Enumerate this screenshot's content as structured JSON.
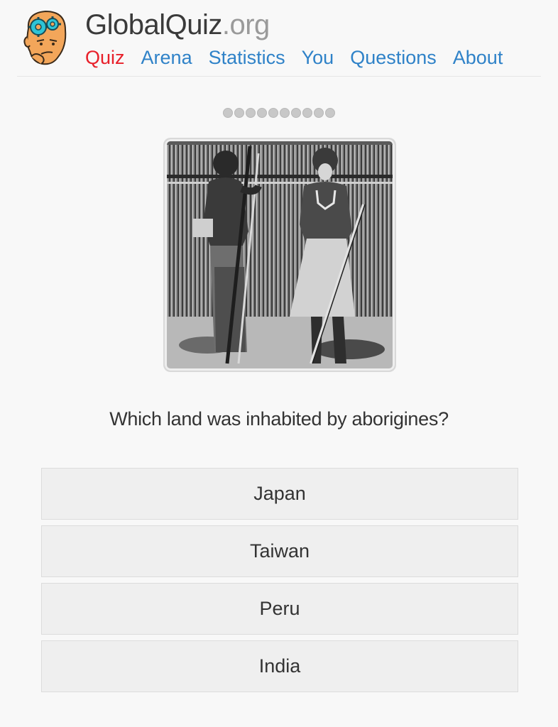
{
  "header": {
    "brand_name": "GlobalQuiz",
    "brand_tld": ".org",
    "nav": [
      {
        "label": "Quiz",
        "active": true
      },
      {
        "label": "Arena",
        "active": false
      },
      {
        "label": "Statistics",
        "active": false
      },
      {
        "label": "You",
        "active": false
      },
      {
        "label": "Questions",
        "active": false
      },
      {
        "label": "About",
        "active": false
      }
    ],
    "logo_icon": "thinking-face-gears-icon"
  },
  "progress": {
    "total": 10,
    "current": 0
  },
  "photo": {
    "style": "black-and-white historical photograph of two men with spears before a bamboo fence"
  },
  "question": {
    "text": "Which land was inhabited by aborigines?"
  },
  "answers": [
    {
      "label": "Japan"
    },
    {
      "label": "Taiwan"
    },
    {
      "label": "Peru"
    },
    {
      "label": "India"
    }
  ],
  "colors": {
    "nav_link": "#2f82c8",
    "nav_active": "#e8202a",
    "background": "#f8f8f8",
    "answer_bg": "#efefef"
  }
}
